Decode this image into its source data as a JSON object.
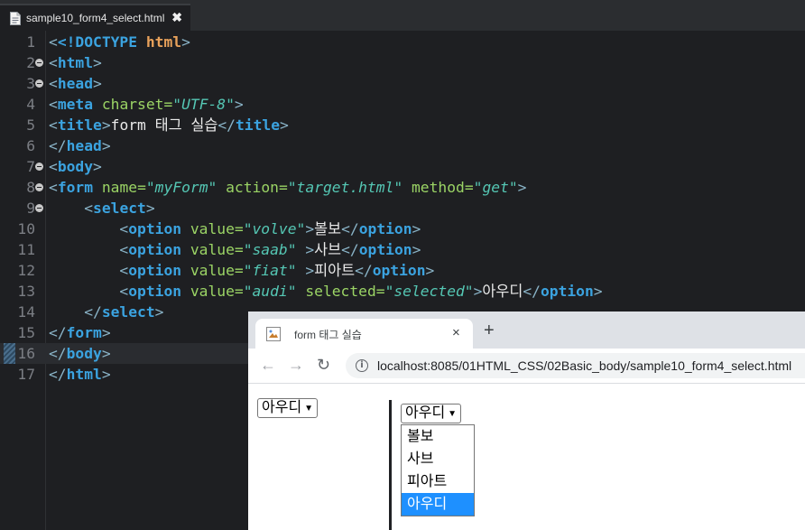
{
  "editor": {
    "tab_title": "sample10_form4_select.html",
    "close_glyph": "✖",
    "lines": [
      {
        "n": "1",
        "fold": false
      },
      {
        "n": "2",
        "fold": true
      },
      {
        "n": "3",
        "fold": true
      },
      {
        "n": "4",
        "fold": false
      },
      {
        "n": "5",
        "fold": false
      },
      {
        "n": "6",
        "fold": false
      },
      {
        "n": "7",
        "fold": true
      },
      {
        "n": "8",
        "fold": true
      },
      {
        "n": "9",
        "fold": true
      },
      {
        "n": "10",
        "fold": false
      },
      {
        "n": "11",
        "fold": false
      },
      {
        "n": "12",
        "fold": false
      },
      {
        "n": "13",
        "fold": false
      },
      {
        "n": "14",
        "fold": false
      },
      {
        "n": "15",
        "fold": false
      },
      {
        "n": "16",
        "fold": false
      },
      {
        "n": "17",
        "fold": false
      }
    ],
    "code": {
      "l1_doctype": "<!DOCTYPE",
      "l1_html": " html",
      "l1_close": ">",
      "tag_html": "html",
      "tag_head": "head",
      "tag_meta": "meta",
      "attr_charset": "charset",
      "val_charset": "\"UTF-8\"",
      "tag_title": "title",
      "title_text": "form 태그 실습",
      "tag_body": "body",
      "tag_form": "form",
      "attr_name": "name",
      "val_name": "\"myForm\"",
      "attr_action": "action",
      "val_action": "\"target.html\"",
      "attr_method": "method",
      "val_method": "\"get\"",
      "tag_select": "select",
      "tag_option": "option",
      "attr_value": "value",
      "val_volve": "\"volve\"",
      "val_saab": "\"saab\"",
      "val_fiat": "\"fiat\"",
      "val_audi": "\"audi\"",
      "attr_selected": "selected",
      "val_selected": "\"selected\"",
      "text_volvo": "볼보",
      "text_saab": "사브",
      "text_fiat": "피아트",
      "text_audi": "아우디"
    }
  },
  "browser": {
    "tab_title": "form 태그 실습",
    "tab_close": "×",
    "new_tab": "+",
    "back": "←",
    "forward": "→",
    "reload": "↻",
    "url": "localhost:8085/01HTML_CSS/02Basic_body/sample10_form4_select.html",
    "select_left_value": "아우디",
    "select_right_value": "아우디",
    "options": [
      "볼보",
      "사브",
      "피아트",
      "아우디"
    ],
    "selected_index": 3,
    "accent_color": "#1e90ff"
  }
}
